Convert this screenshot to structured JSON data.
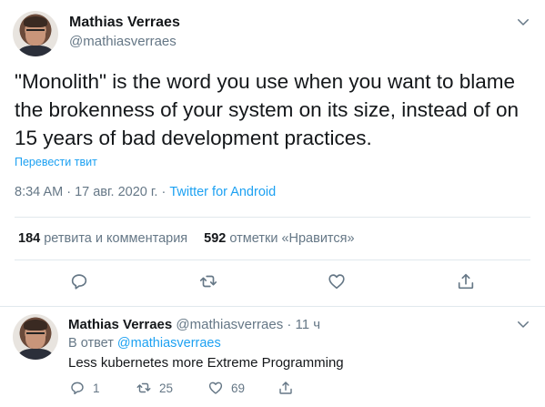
{
  "main_tweet": {
    "author_name": "Mathias Verraes",
    "author_handle": "@mathiasverraes",
    "text_line1": "\"Monolith\" is the word you use when you want to blame",
    "text_line2": "the brokenness of your system on its size, instead of on",
    "text_line3": "15 years of bad development practices.",
    "translate_link": "Перевести твит",
    "timestamp": "8:34 AM · 17 авг. 2020 г. · ",
    "source": "Twitter for Android",
    "retweets_count": "184",
    "retweets_label": " ретвита и комментария",
    "likes_count": "592",
    "likes_label": " отметки «Нравится»"
  },
  "reply": {
    "author_name": "Mathias Verraes",
    "author_handle": "@mathiasverraes",
    "time": " · 11 ч",
    "reply_to_prefix": "В ответ ",
    "reply_to_mention": "@mathiasverraes",
    "text": "Less kubernetes more Extreme Programming",
    "reply_count": "1",
    "retweet_count": "25",
    "like_count": "69"
  },
  "icons": [
    "chevron-down-icon",
    "reply-icon",
    "retweet-icon",
    "like-icon",
    "share-icon"
  ],
  "colors": {
    "accent": "#1da1f2",
    "text": "#14171a",
    "muted": "#657786",
    "divider": "#e1e8ed"
  }
}
